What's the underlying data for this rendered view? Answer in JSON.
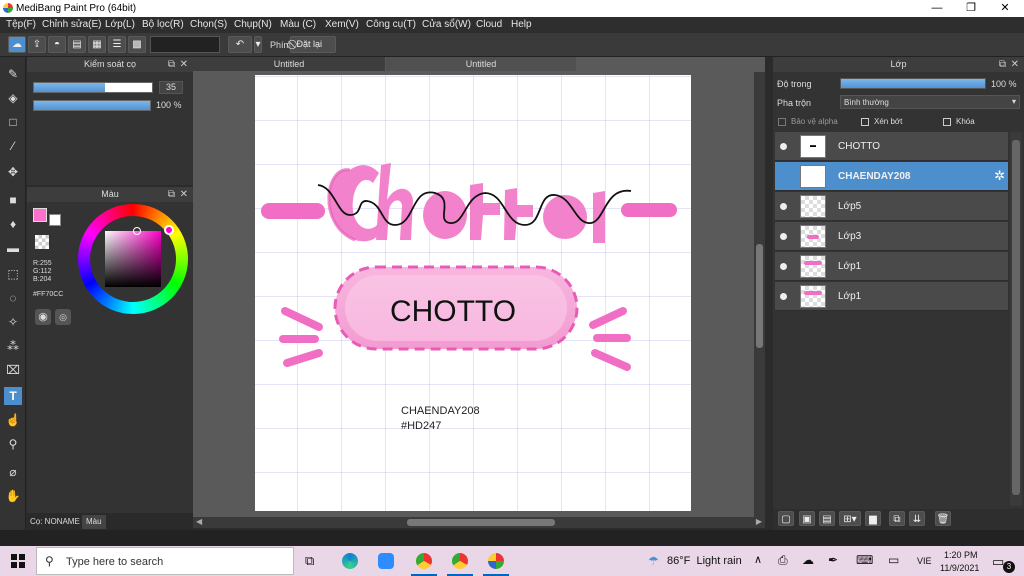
{
  "window": {
    "title": "MediBang Paint Pro (64bit)",
    "minimize": "—",
    "restore": "❐",
    "close": "✕"
  },
  "menu": [
    "Tệp(F)",
    "Chỉnh sửa(E)",
    "Lớp(L)",
    "Bộ lọc(R)",
    "Chọn(S)",
    "Chụp(N)",
    "Màu (C)",
    "Xem(V)",
    "Công cụ(T)",
    "Cửa sổ(W)",
    "Cloud",
    "Help"
  ],
  "toolbar": {
    "hotkey_label": "Phím",
    "reset_label": "Đặt lại"
  },
  "brush_panel": {
    "title": "Kiểm soát cọ",
    "size_value": "35",
    "size_fill": 0.6,
    "opacity_value": "100 %",
    "opacity_fill": 1.0
  },
  "color_panel": {
    "title": "Màu",
    "r": "R:255",
    "g": "G:112",
    "b": "B:204",
    "hex": "#FF70CC",
    "fg_color": "#ff70cc"
  },
  "canvas": {
    "tabs": [
      "Untitled",
      "Untitled"
    ],
    "banner_text": "CHOTTO",
    "credit_line1": "CHAENDAY208",
    "credit_line2": "#HD247"
  },
  "layer_panel": {
    "title": "Lớp",
    "opacity_label": "Độ trong",
    "opacity_value": "100 %",
    "opacity_fill": 1.0,
    "blend_label": "Pha trộn",
    "blend_value": "Bình thường",
    "protect_alpha": "Bảo vệ alpha",
    "clipping": "Xén bớt",
    "lock": "Khóa",
    "layers": [
      {
        "name": "CHOTTO",
        "selected": false
      },
      {
        "name": "CHAENDAY208",
        "selected": true
      },
      {
        "name": "Lớp5",
        "selected": false
      },
      {
        "name": "Lớp3",
        "selected": false
      },
      {
        "name": "Lớp1",
        "selected": false
      },
      {
        "name": "Lớp1",
        "selected": false
      }
    ]
  },
  "bottom_left": {
    "brush_tab": "Cọ: NONAME",
    "color_tab": "Màu"
  },
  "taskbar": {
    "search_placeholder": "Type here to search",
    "weather": "86°F  Light rain",
    "lang": "VIE",
    "time": "1:20 PM",
    "date": "11/9/2021",
    "notif_count": "3"
  }
}
